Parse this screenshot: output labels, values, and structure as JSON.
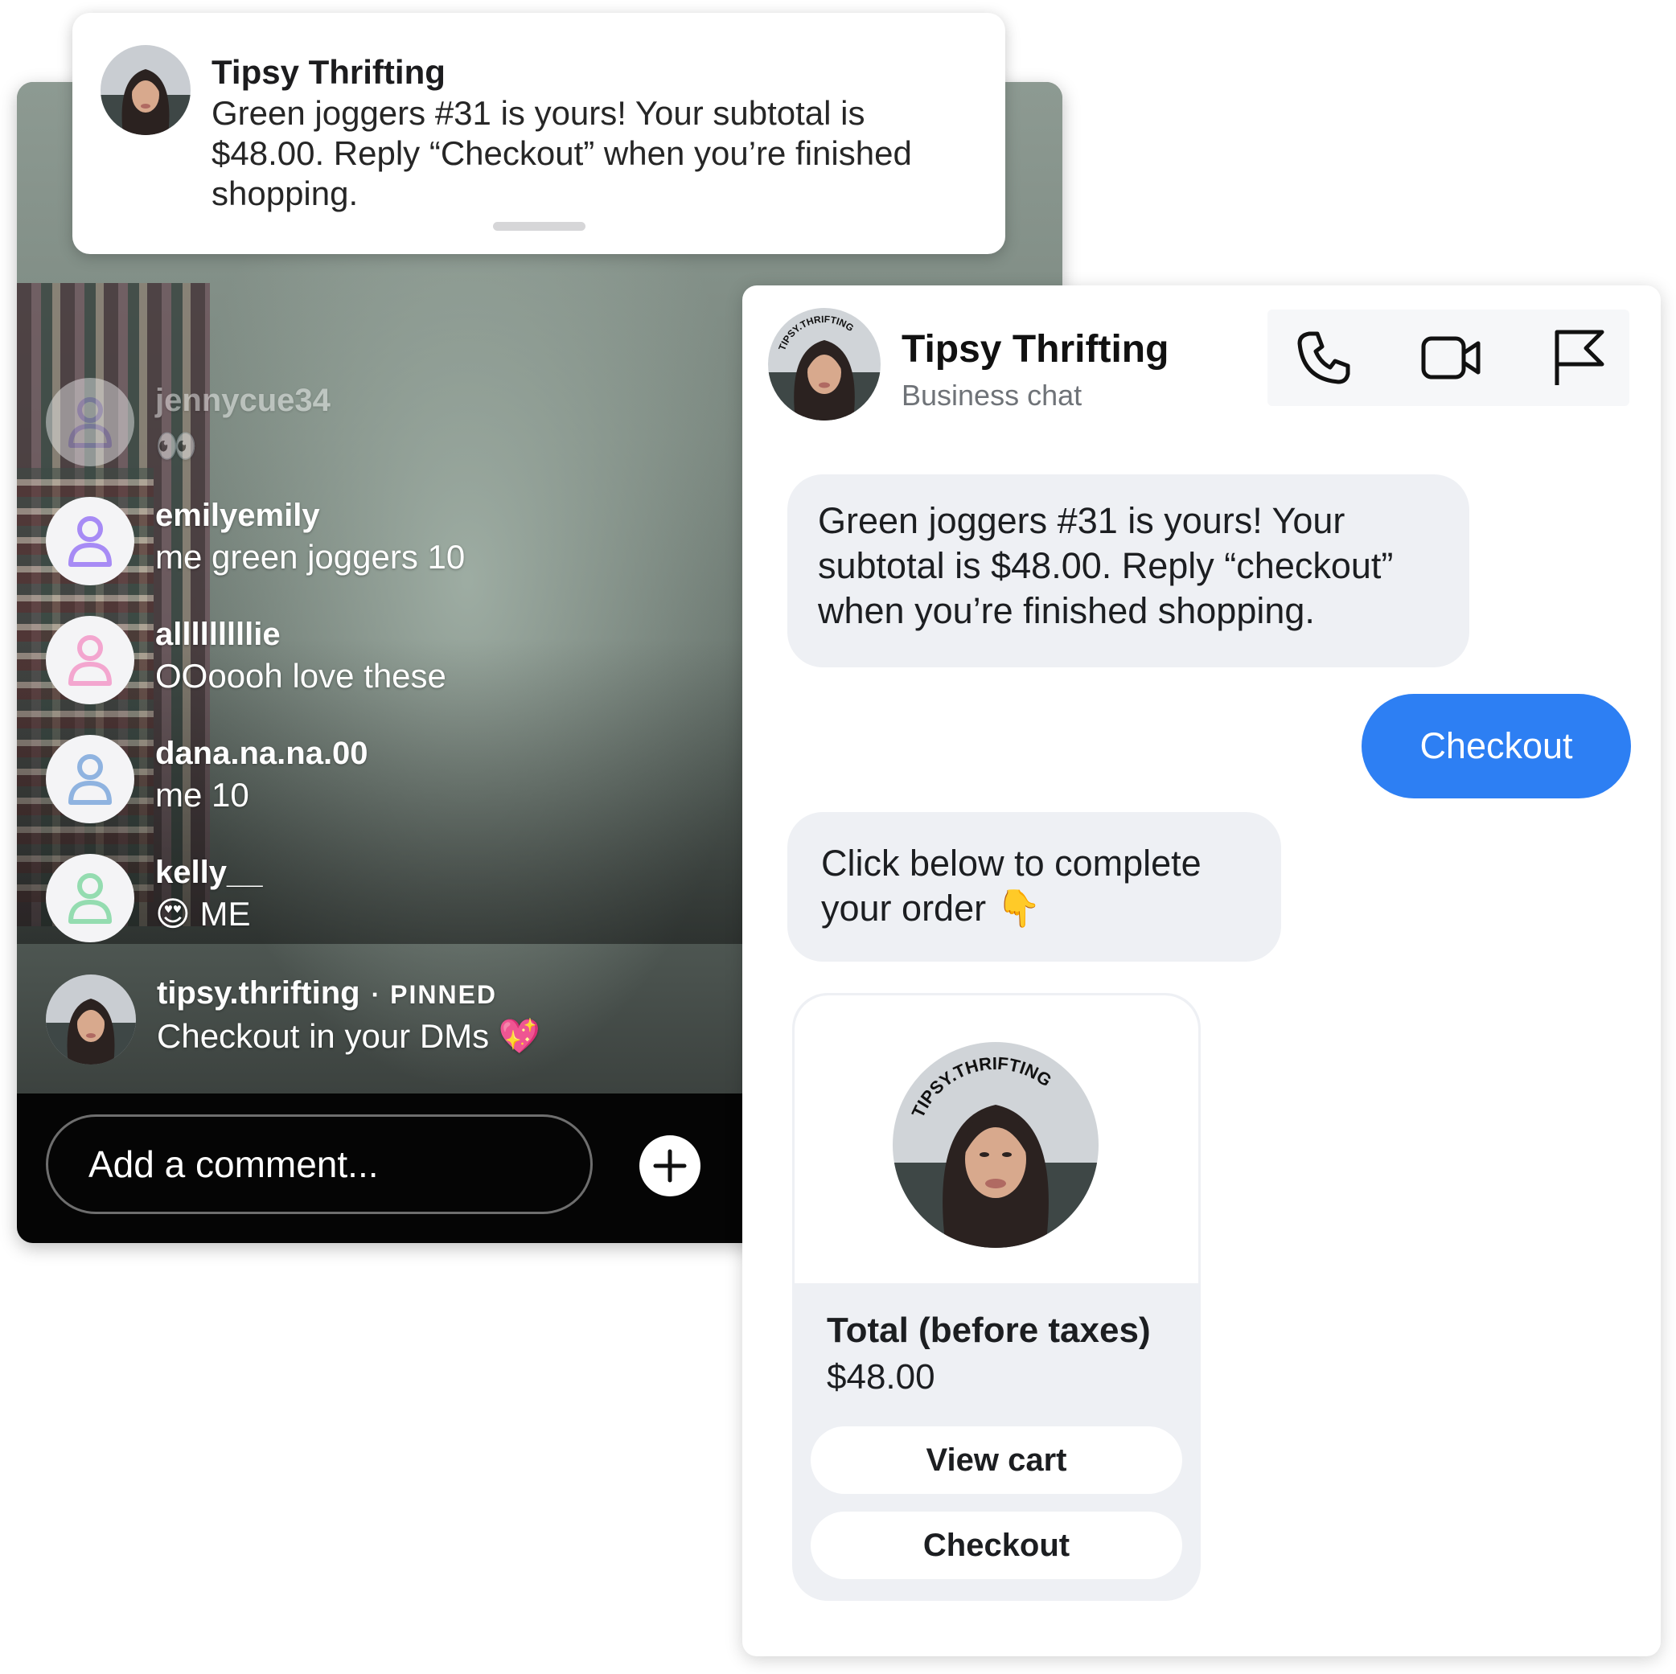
{
  "notification": {
    "title": "Tipsy Thrifting",
    "body": "Green joggers #31 is yours! Your subtotal is $48.00. Reply “Checkout” when you’re finished shopping."
  },
  "live": {
    "comments": [
      {
        "user": "jennycue34",
        "message": "👀",
        "avatar_color": "#b9aef7",
        "faded": true
      },
      {
        "user": "emilyemily",
        "message": "me green joggers 10",
        "avatar_color": "#a78bf5"
      },
      {
        "user": "alllllllllie",
        "message": "OOoooh love these",
        "avatar_color": "#f3a6cf"
      },
      {
        "user": "dana.na.na.00",
        "message": "me 10",
        "avatar_color": "#8fb3e0"
      },
      {
        "user": "kelly__",
        "emoji": "😍",
        "message": "ME",
        "avatar_color": "#94dcb0"
      }
    ],
    "pinned": {
      "user": "tipsy.thrifting",
      "tag": "· PINNED",
      "message": "Checkout in your DMs",
      "emoji": "💖"
    },
    "comment_placeholder": "Add a comment..."
  },
  "chat": {
    "name": "Tipsy Thrifting",
    "subtitle": "Business chat",
    "actions": [
      "phone-icon",
      "video-icon",
      "flag-icon"
    ],
    "messages": {
      "first": "Green joggers #31 is yours! Your subtotal is $48.00. Reply “checkout” when you’re finished shopping.",
      "reply": "Checkout",
      "prompt": "Click below to complete your order",
      "prompt_emoji": "👇"
    },
    "order": {
      "label": "Total (before taxes)",
      "price": "$48.00",
      "view_cart": "View cart",
      "checkout": "Checkout"
    },
    "colors": {
      "accent": "#2d7ff3",
      "bubble": "#eef0f4"
    }
  },
  "brand_ring_text": "TIPSY.THRIFTING"
}
